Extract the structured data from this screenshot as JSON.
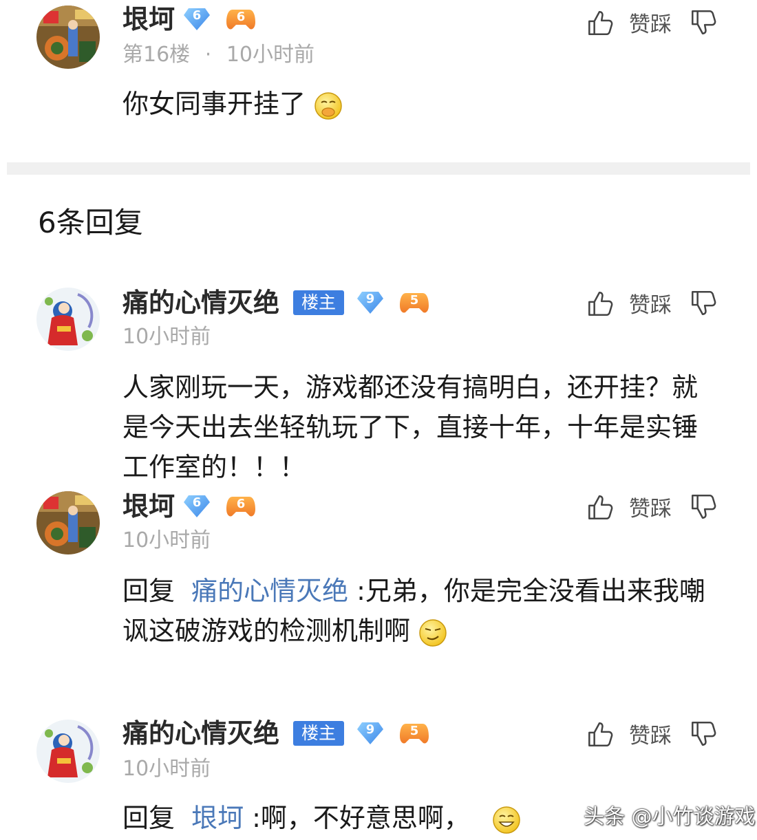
{
  "original": {
    "username": "垠坷",
    "level": "6",
    "game_level": "6",
    "floor": "第16楼",
    "separator": "·",
    "time": "10小时前",
    "text": "你女同事开挂了",
    "like_label": "赞踩"
  },
  "reply_count": "6条回复",
  "replies": [
    {
      "username": "痛的心情灭绝",
      "host_tag": "楼主",
      "level": "9",
      "game_level": "5",
      "time": "10小时前",
      "text": "人家刚玩一天，游戏都还没有搞明白，还开挂？就是今天出去坐轻轨玩了下，直接十年，十年是实锤工作室的！！！",
      "like_label": "赞踩"
    },
    {
      "username": "垠坷",
      "level": "6",
      "game_level": "6",
      "time": "10小时前",
      "reply_prefix": "回复",
      "mention": "痛的心情灭绝",
      "text": ":兄弟，你是完全没看出来我嘲讽这破游戏的检测机制啊",
      "like_label": "赞踩"
    },
    {
      "username": "痛的心情灭绝",
      "host_tag": "楼主",
      "level": "9",
      "game_level": "5",
      "time": "10小时前",
      "reply_prefix": "回复",
      "mention": "垠坷",
      "text": ":啊，不好意思啊，",
      "like_label": "赞踩"
    }
  ],
  "watermark": "头条 @小竹谈游戏",
  "colors": {
    "host_tag": "#3d7ee0",
    "mention": "#4a78b8",
    "meta": "#a9a9a9",
    "divider": "#f0f0f0"
  },
  "icons": {
    "like": "thumbs-up-icon",
    "dislike": "thumbs-down-icon",
    "level": "diamond-level-icon",
    "game": "gamepad-level-icon"
  }
}
